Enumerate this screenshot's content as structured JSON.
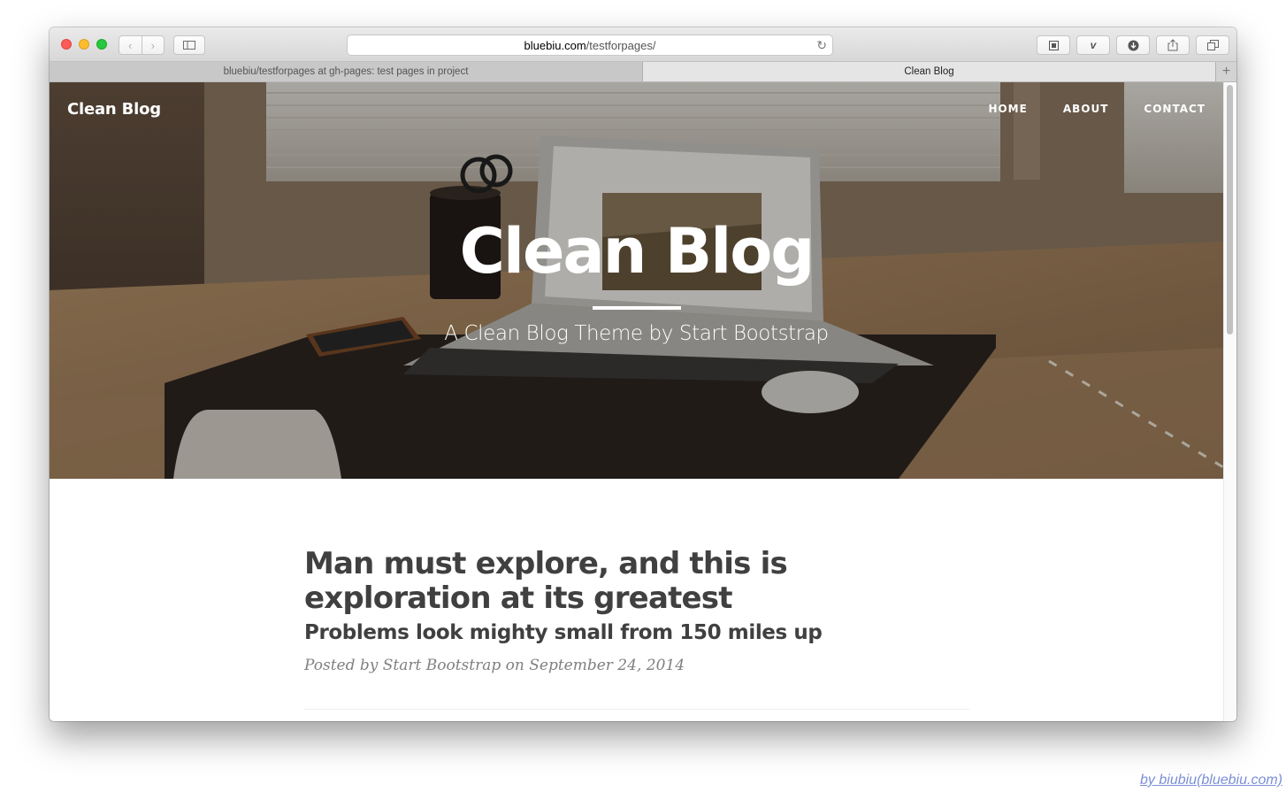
{
  "browser": {
    "address": {
      "domain": "bluebiu.com",
      "path": "/testforpages/"
    },
    "tabs": [
      {
        "label": "bluebiu/testforpages at gh-pages: test pages in project"
      },
      {
        "label": "Clean Blog"
      }
    ]
  },
  "site": {
    "brand": "Clean Blog",
    "nav": [
      "HOME",
      "ABOUT",
      "CONTACT"
    ]
  },
  "hero": {
    "title": "Clean Blog",
    "subtitle": "A Clean Blog Theme by Start Bootstrap"
  },
  "post": {
    "title": "Man must explore, and this is exploration at its greatest",
    "subtitle": "Problems look mighty small from 150 miles up",
    "meta": "Posted by Start Bootstrap on September 24, 2014"
  },
  "credit": "by biubiu(bluebiu.com)",
  "colors": {
    "text_dark": "#404040",
    "meta_gray": "#808080",
    "credit_link": "#7b8fd6"
  }
}
